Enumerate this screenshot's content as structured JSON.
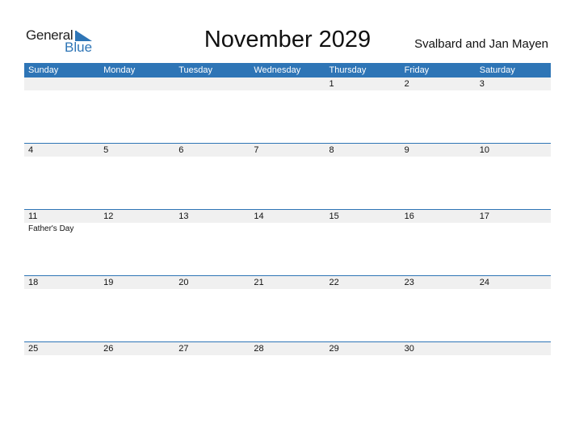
{
  "logo": {
    "general": "General",
    "blue": "Blue"
  },
  "title": "November 2029",
  "region": "Svalbard and Jan Mayen",
  "colors": {
    "accent": "#2e75b6",
    "date_band": "#f0f0f0"
  },
  "weekdays": [
    "Sunday",
    "Monday",
    "Tuesday",
    "Wednesday",
    "Thursday",
    "Friday",
    "Saturday"
  ],
  "weeks": [
    {
      "days": [
        "",
        "",
        "",
        "",
        "1",
        "2",
        "3"
      ],
      "events": [
        "",
        "",
        "",
        "",
        "",
        "",
        ""
      ]
    },
    {
      "days": [
        "4",
        "5",
        "6",
        "7",
        "8",
        "9",
        "10"
      ],
      "events": [
        "",
        "",
        "",
        "",
        "",
        "",
        ""
      ]
    },
    {
      "days": [
        "11",
        "12",
        "13",
        "14",
        "15",
        "16",
        "17"
      ],
      "events": [
        "Father's Day",
        "",
        "",
        "",
        "",
        "",
        ""
      ]
    },
    {
      "days": [
        "18",
        "19",
        "20",
        "21",
        "22",
        "23",
        "24"
      ],
      "events": [
        "",
        "",
        "",
        "",
        "",
        "",
        ""
      ]
    },
    {
      "days": [
        "25",
        "26",
        "27",
        "28",
        "29",
        "30",
        ""
      ],
      "events": [
        "",
        "",
        "",
        "",
        "",
        "",
        ""
      ]
    }
  ]
}
